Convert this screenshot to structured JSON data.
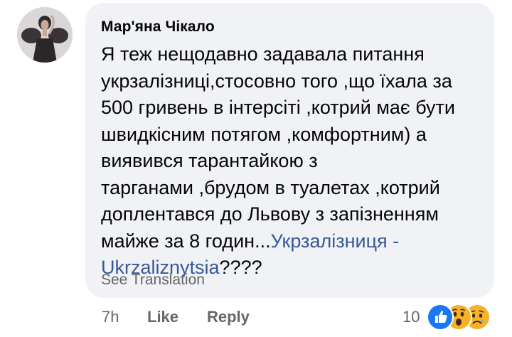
{
  "comment": {
    "author": "Мар'яна Чікало",
    "body_lines": [
      "Я теж нещодавно задавала питання",
      "укрзалізниці,стосовно того ,що їхала за",
      "500 гривень в інтерсіті ,котрий має бути",
      "швидкісним потягом ,комфортним) а",
      "виявився тарантайкою з",
      "тарганами ,брудом в туалетах ,котрий",
      "доплентався до Львову з запізненням"
    ],
    "last_line_prefix": "майже за 8 годин...",
    "mention_part1": "Укрзалізниця -",
    "mention_part2": "Ukrzaliznytsia",
    "trailing_text": "????",
    "see_translation": "See Translation"
  },
  "actions": {
    "time": "7h",
    "like_label": "Like",
    "reply_label": "Reply",
    "reaction_count": "10",
    "reactions": [
      "like-reaction-icon",
      "wow-reaction-icon",
      "sad-reaction-icon"
    ]
  },
  "colors": {
    "bubble_bg": "#f0f2f5",
    "link": "#385898",
    "meta": "#65676b",
    "like_blue": "#1877f2",
    "emoji_yellow": "#f7b125"
  }
}
